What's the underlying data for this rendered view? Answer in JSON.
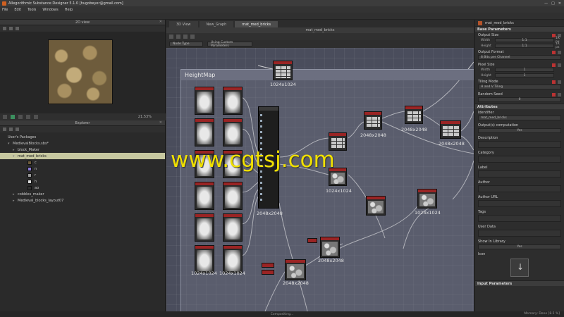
{
  "window": {
    "title": "Allegorithmic Substance Designer 5.1.0 [hugobeyer@gmail.com]",
    "controls": [
      "—",
      "□",
      "✕"
    ]
  },
  "menu": [
    "File",
    "Edit",
    "Tools",
    "Windows",
    "Help"
  ],
  "view2d": {
    "header": "2D view",
    "zoom": "21.53%"
  },
  "explorer": {
    "header": "Explorer",
    "items": [
      {
        "label": "User's Packages",
        "indent": 0,
        "twisty": ""
      },
      {
        "label": "MedievalBlocks.sbs*",
        "indent": 1,
        "twisty": "▾"
      },
      {
        "label": "block_Maker",
        "indent": 2,
        "twisty": "▸"
      },
      {
        "label": "mat_med_bricks",
        "indent": 2,
        "twisty": "▾",
        "selected": true
      },
      {
        "label": "c",
        "indent": 4,
        "twisty": "",
        "swatch": "#6a5a3a"
      },
      {
        "label": "n",
        "indent": 4,
        "twisty": "",
        "swatch": "#8a7ad8"
      },
      {
        "label": "r",
        "indent": 4,
        "twisty": "",
        "swatch": "#9a9a9a"
      },
      {
        "label": "h",
        "indent": 4,
        "twisty": "",
        "swatch": "#dcdcdc"
      },
      {
        "label": "ao",
        "indent": 4,
        "twisty": "",
        "swatch": "#303030"
      },
      {
        "label": "cobbles_maker",
        "indent": 2,
        "twisty": "▸"
      },
      {
        "label": "Medieval_blocks_layout07",
        "indent": 2,
        "twisty": "▸"
      }
    ]
  },
  "graph": {
    "tabs": [
      {
        "label": "3D View",
        "active": false
      },
      {
        "label": "New_Graph",
        "active": false
      },
      {
        "label": "mat_med_bricks",
        "active": true
      }
    ],
    "header": "mat_med_bricks",
    "filter": {
      "node_type": "Node Type",
      "parameters": "Using Custom Parameters"
    },
    "frame_title": "HeightMap",
    "labels": {
      "top": "1024x1024",
      "col1": "1024x1024",
      "col2": "1024x1024",
      "blend": "2048x2048",
      "mid1": "1024x1024",
      "m2048a": "2048x2048",
      "m2048b": "2048x2048",
      "m2048c": "2048x2048",
      "r1024": "1024x1024",
      "b2048a": "2048x2048",
      "b2048b": "2048x2048"
    }
  },
  "watermark": "www.cgtsj.com",
  "status": {
    "center": "Compositing...",
    "memory": "Memory: Done [8.5 %]"
  },
  "properties": {
    "tab": "mat_med_bricks",
    "sections": {
      "base": "Base Parameters",
      "attributes": "Attributes",
      "input": "Input Parameters"
    },
    "output_size": {
      "label": "Output Size",
      "width_label": "Width",
      "height_label": "Height",
      "width": "1:1",
      "height": "1:1",
      "width_unit": "1K px",
      "height_unit": "1K px"
    },
    "output_format": {
      "label": "Output Format",
      "value": "8 Bits per Channel"
    },
    "pixel_size": {
      "label": "Pixel Size",
      "width_label": "Width",
      "height_label": "Height",
      "width": "1",
      "height": "1"
    },
    "tiling": {
      "label": "Tiling Mode",
      "value": "H and V Tiling"
    },
    "random_seed": {
      "label": "Random Seed",
      "value": "0"
    },
    "identifier": {
      "label": "Identifier",
      "value": "mat_med_bricks"
    },
    "outputs_comp": {
      "label": "Output(s) computation",
      "value": "Yes"
    },
    "fields": [
      "Description",
      "Category",
      "Label",
      "Author",
      "Author URL",
      "Tags",
      "User Data"
    ],
    "show_library": {
      "label": "Show In Library",
      "value": "Yes"
    },
    "icon_label": "Icon"
  }
}
